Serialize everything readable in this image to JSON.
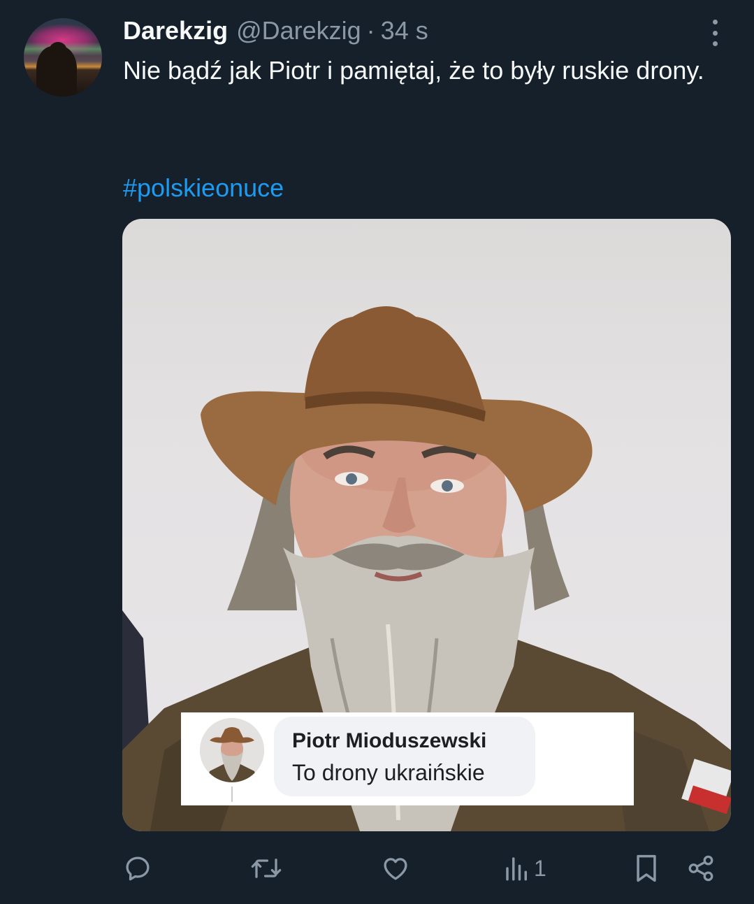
{
  "tweet": {
    "display_name": "Darekzig",
    "handle": "@Darekzig",
    "separator": "·",
    "time": "34 s",
    "text": "Nie bądź jak Piotr i pamiętaj, że to były ruskie drony.",
    "hashtag": "#polskieonuce"
  },
  "media": {
    "comment": {
      "author": "Piotr Mioduszewski",
      "text": "To drony ukraińskie"
    }
  },
  "actions": {
    "reply_icon": "reply-icon",
    "retweet_icon": "retweet-icon",
    "like_icon": "heart-icon",
    "views_icon": "views-icon",
    "views_count": "1",
    "bookmark_icon": "bookmark-icon",
    "share_icon": "share-icon"
  },
  "colors": {
    "background": "#15202b",
    "text": "#f7f9f9",
    "secondary": "#8b98a5",
    "accent": "#1d9bf0"
  }
}
